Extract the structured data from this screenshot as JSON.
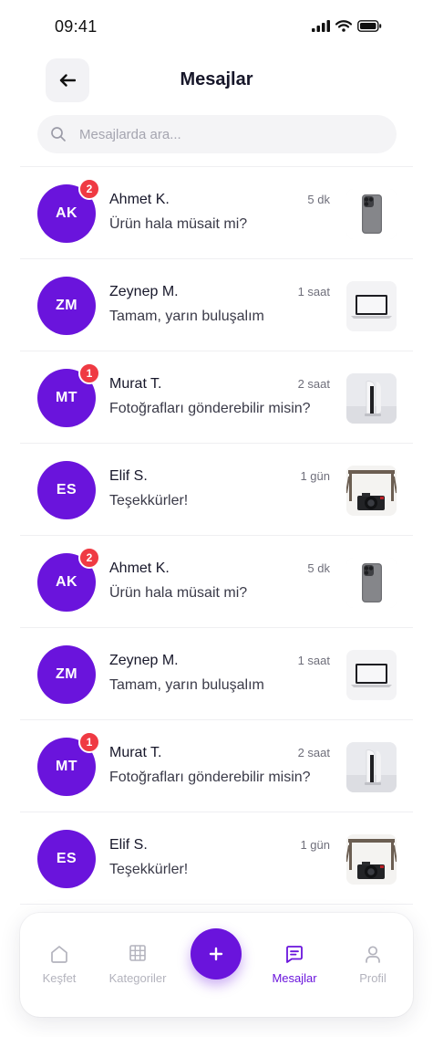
{
  "status_bar": {
    "time": "09:41"
  },
  "header": {
    "title": "Mesajlar"
  },
  "search": {
    "placeholder": "Mesajlarda ara..."
  },
  "conversations": [
    {
      "initials": "AK",
      "name": "Ahmet K.",
      "time": "5 dk",
      "message": "Ürün hala müsait mi?",
      "unread": "2",
      "thumb": "phone"
    },
    {
      "initials": "ZM",
      "name": "Zeynep M.",
      "time": "1 saat",
      "message": "Tamam, yarın buluşalım",
      "unread": null,
      "thumb": "laptop"
    },
    {
      "initials": "MT",
      "name": "Murat T.",
      "time": "2 saat",
      "message": "Fotoğrafları gönderebilir misin?",
      "unread": "1",
      "thumb": "console"
    },
    {
      "initials": "ES",
      "name": "Elif S.",
      "time": "1 gün",
      "message": "Teşekkürler!",
      "unread": null,
      "thumb": "camera"
    },
    {
      "initials": "AK",
      "name": "Ahmet K.",
      "time": "5 dk",
      "message": "Ürün hala müsait mi?",
      "unread": "2",
      "thumb": "phone"
    },
    {
      "initials": "ZM",
      "name": "Zeynep M.",
      "time": "1 saat",
      "message": "Tamam, yarın buluşalım",
      "unread": null,
      "thumb": "laptop"
    },
    {
      "initials": "MT",
      "name": "Murat T.",
      "time": "2 saat",
      "message": "Fotoğrafları gönderebilir misin?",
      "unread": "1",
      "thumb": "console"
    },
    {
      "initials": "ES",
      "name": "Elif S.",
      "time": "1 gün",
      "message": "Teşekkürler!",
      "unread": null,
      "thumb": "camera"
    }
  ],
  "tabbar": {
    "tabs": [
      {
        "label": "Keşfet",
        "icon": "home-icon",
        "active": false
      },
      {
        "label": "Kategoriler",
        "icon": "grid-icon",
        "active": false
      },
      {
        "label": "Mesajlar",
        "icon": "message-icon",
        "active": true
      },
      {
        "label": "Profil",
        "icon": "user-icon",
        "active": false
      }
    ],
    "fab_icon": "plus-icon"
  },
  "colors": {
    "accent": "#6a14dc",
    "badge": "#ef3a43",
    "text": "#17172a",
    "muted": "#b3b3bd"
  }
}
